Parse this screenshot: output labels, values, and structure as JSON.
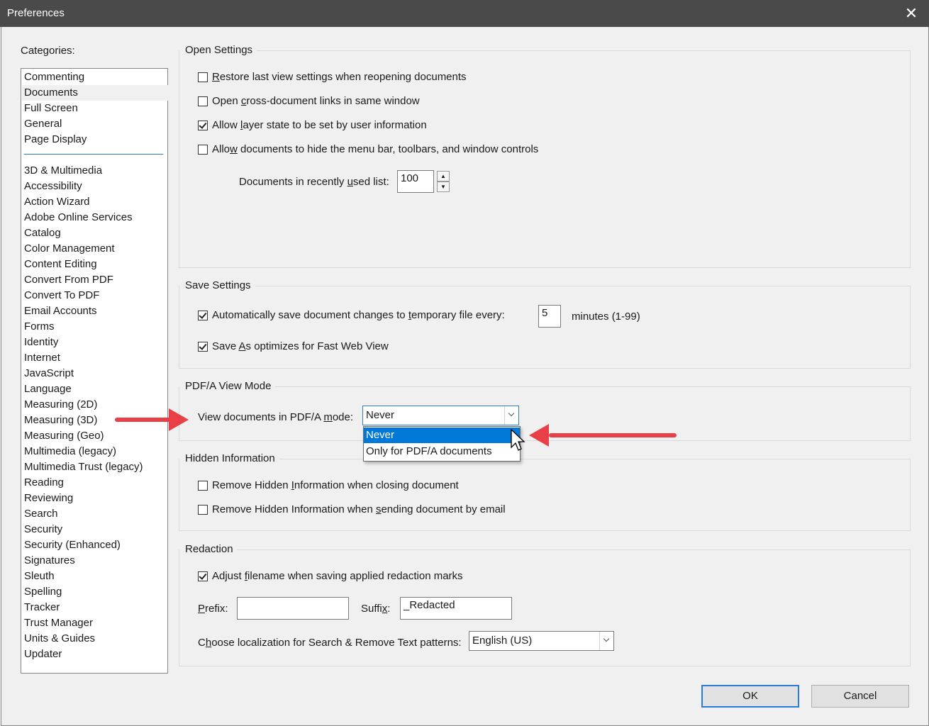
{
  "window": {
    "title": "Preferences",
    "close_glyph": "✕"
  },
  "categories": {
    "label": "Categories:",
    "top_items": [
      "Commenting",
      "Documents",
      "Full Screen",
      "General",
      "Page Display"
    ],
    "selected": "Documents",
    "items": [
      "3D & Multimedia",
      "Accessibility",
      "Action Wizard",
      "Adobe Online Services",
      "Catalog",
      "Color Management",
      "Content Editing",
      "Convert From PDF",
      "Convert To PDF",
      "Email Accounts",
      "Forms",
      "Identity",
      "Internet",
      "JavaScript",
      "Language",
      "Measuring (2D)",
      "Measuring (3D)",
      "Measuring (Geo)",
      "Multimedia (legacy)",
      "Multimedia Trust (legacy)",
      "Reading",
      "Reviewing",
      "Search",
      "Security",
      "Security (Enhanced)",
      "Signatures",
      "Sleuth",
      "Spelling",
      "Tracker",
      "Trust Manager",
      "Units & Guides",
      "Updater"
    ]
  },
  "open_settings": {
    "title": "Open Settings",
    "restore": {
      "pre": "",
      "u": "R",
      "post": "estore last view settings when reopening documents",
      "checked": false
    },
    "crossdoc": {
      "pre": "Open ",
      "u": "c",
      "post": "ross-document links in same window",
      "checked": false
    },
    "layer": {
      "pre": "Allow ",
      "u": "l",
      "post": "ayer state to be set by user information",
      "checked": true
    },
    "hide": {
      "pre": "Allo",
      "u": "w",
      "post": " documents to hide the menu bar, toolbars, and window controls",
      "checked": false
    },
    "recent": {
      "pre": "Documents in recently ",
      "u": "u",
      "post": "sed list:",
      "value": "100"
    }
  },
  "save_settings": {
    "title": "Save Settings",
    "autosave": {
      "pre": "Automatically save document changes to ",
      "u": "t",
      "post": "emporary file every:",
      "checked": true,
      "value": "5",
      "unit": "minutes (1-99)"
    },
    "fastweb": {
      "pre": "Save ",
      "u": "A",
      "post": "s optimizes for Fast Web View",
      "checked": true
    }
  },
  "pdfa": {
    "title": "PDF/A View Mode",
    "label_pre": "View documents in PDF/A ",
    "label_u": "m",
    "label_post": "ode:",
    "value": "Never",
    "options": [
      "Never",
      "Only for PDF/A documents"
    ]
  },
  "hidden_info": {
    "title": "Hidden Information",
    "closing": {
      "pre": "Remove Hidden ",
      "u": "I",
      "post": "nformation when closing document",
      "checked": false
    },
    "email": {
      "pre": "Remove Hidden Information when ",
      "u": "s",
      "post": "ending document by email",
      "checked": false
    }
  },
  "redaction": {
    "title": "Redaction",
    "adjust": {
      "pre": "Adjust ",
      "u": "f",
      "post": "ilename when saving applied redaction marks",
      "checked": true
    },
    "prefix": {
      "pre": "",
      "u": "P",
      "post": "refix:",
      "value": ""
    },
    "suffix": {
      "pre": "Suffi",
      "u": "x",
      "post": ":",
      "value": "_Redacted"
    },
    "locale": {
      "pre": "C",
      "u": "h",
      "post": "oose localization for Search & Remove Text patterns:",
      "value": "English (US)"
    }
  },
  "buttons": {
    "ok": "OK",
    "cancel": "Cancel"
  },
  "colors": {
    "accent": "#0078d7",
    "arrow": "#e84046",
    "titlebar": "#4a4a4a"
  }
}
